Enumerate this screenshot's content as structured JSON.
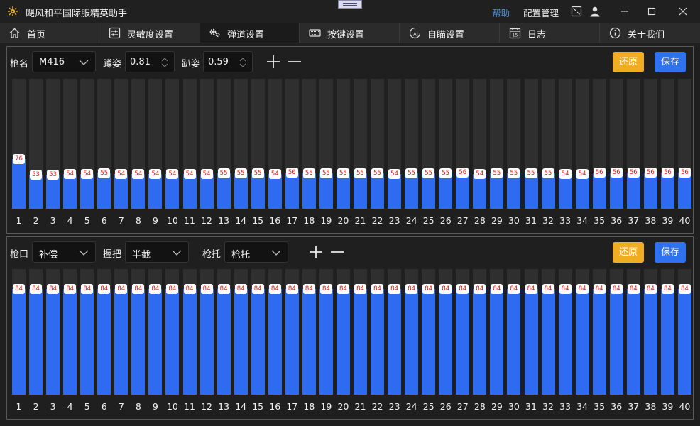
{
  "app": {
    "title": "飓风和平国际服精英助手",
    "help": "帮助",
    "config_manage": "配置管理"
  },
  "tabs": [
    {
      "label": "首页",
      "icon": "home-icon"
    },
    {
      "label": "灵敏度设置",
      "icon": "sliders-icon"
    },
    {
      "label": "弹道设置",
      "icon": "gears-icon"
    },
    {
      "label": "按键设置",
      "icon": "keyboard-icon"
    },
    {
      "label": "自瞄设置",
      "icon": "aim-ai-icon"
    },
    {
      "label": "日志",
      "icon": "calendar-icon"
    },
    {
      "label": "关于我们",
      "icon": "info-icon"
    }
  ],
  "active_tab": 2,
  "top_panel": {
    "gun_label": "枪名",
    "gun_value": "M416",
    "crouch_label": "蹲姿",
    "crouch_value": "0.81",
    "prone_label": "趴姿",
    "prone_value": "0.59",
    "restore_label": "还原",
    "save_label": "保存",
    "chart_data": {
      "type": "bar",
      "categories": [
        "1",
        "2",
        "3",
        "4",
        "5",
        "6",
        "7",
        "8",
        "9",
        "10",
        "11",
        "12",
        "13",
        "14",
        "15",
        "16",
        "17",
        "18",
        "19",
        "20",
        "21",
        "22",
        "23",
        "24",
        "25",
        "26",
        "27",
        "28",
        "29",
        "30",
        "31",
        "32",
        "33",
        "34",
        "35",
        "36",
        "37",
        "38",
        "39",
        "40"
      ],
      "values": [
        76,
        53,
        53,
        54,
        54,
        55,
        54,
        54,
        54,
        54,
        54,
        54,
        55,
        55,
        55,
        54,
        56,
        55,
        55,
        55,
        55,
        55,
        54,
        55,
        55,
        55,
        56,
        54,
        55,
        55,
        55,
        55,
        54,
        54,
        56,
        56,
        56,
        56,
        56,
        56
      ],
      "ylim": [
        0,
        200
      ]
    }
  },
  "bottom_panel": {
    "muzzle_label": "枪口",
    "muzzle_value": "补偿",
    "grip_label": "握把",
    "grip_value": "半截",
    "stock_label": "枪托",
    "stock_value": "枪托",
    "restore_label": "还原",
    "save_label": "保存",
    "chart_data": {
      "type": "bar",
      "categories": [
        "1",
        "2",
        "3",
        "4",
        "5",
        "6",
        "7",
        "8",
        "9",
        "10",
        "11",
        "12",
        "13",
        "14",
        "15",
        "16",
        "17",
        "18",
        "19",
        "20",
        "21",
        "22",
        "23",
        "24",
        "25",
        "26",
        "27",
        "28",
        "29",
        "30",
        "31",
        "32",
        "33",
        "34",
        "35",
        "36",
        "37",
        "38",
        "39",
        "40"
      ],
      "values": [
        84,
        84,
        84,
        84,
        84,
        84,
        84,
        84,
        84,
        84,
        84,
        84,
        84,
        84,
        84,
        84,
        84,
        84,
        84,
        84,
        84,
        84,
        84,
        84,
        84,
        84,
        84,
        84,
        84,
        84,
        84,
        84,
        84,
        84,
        84,
        84,
        84,
        84,
        84,
        84
      ],
      "ylim": [
        0,
        100
      ]
    }
  },
  "colors": {
    "bar_fill": "#2e6bf0",
    "bar_track": "#2f2f2f",
    "restore_button": "#f0ad22",
    "save_button": "#2f72f0",
    "help_link": "#4a90e2"
  }
}
